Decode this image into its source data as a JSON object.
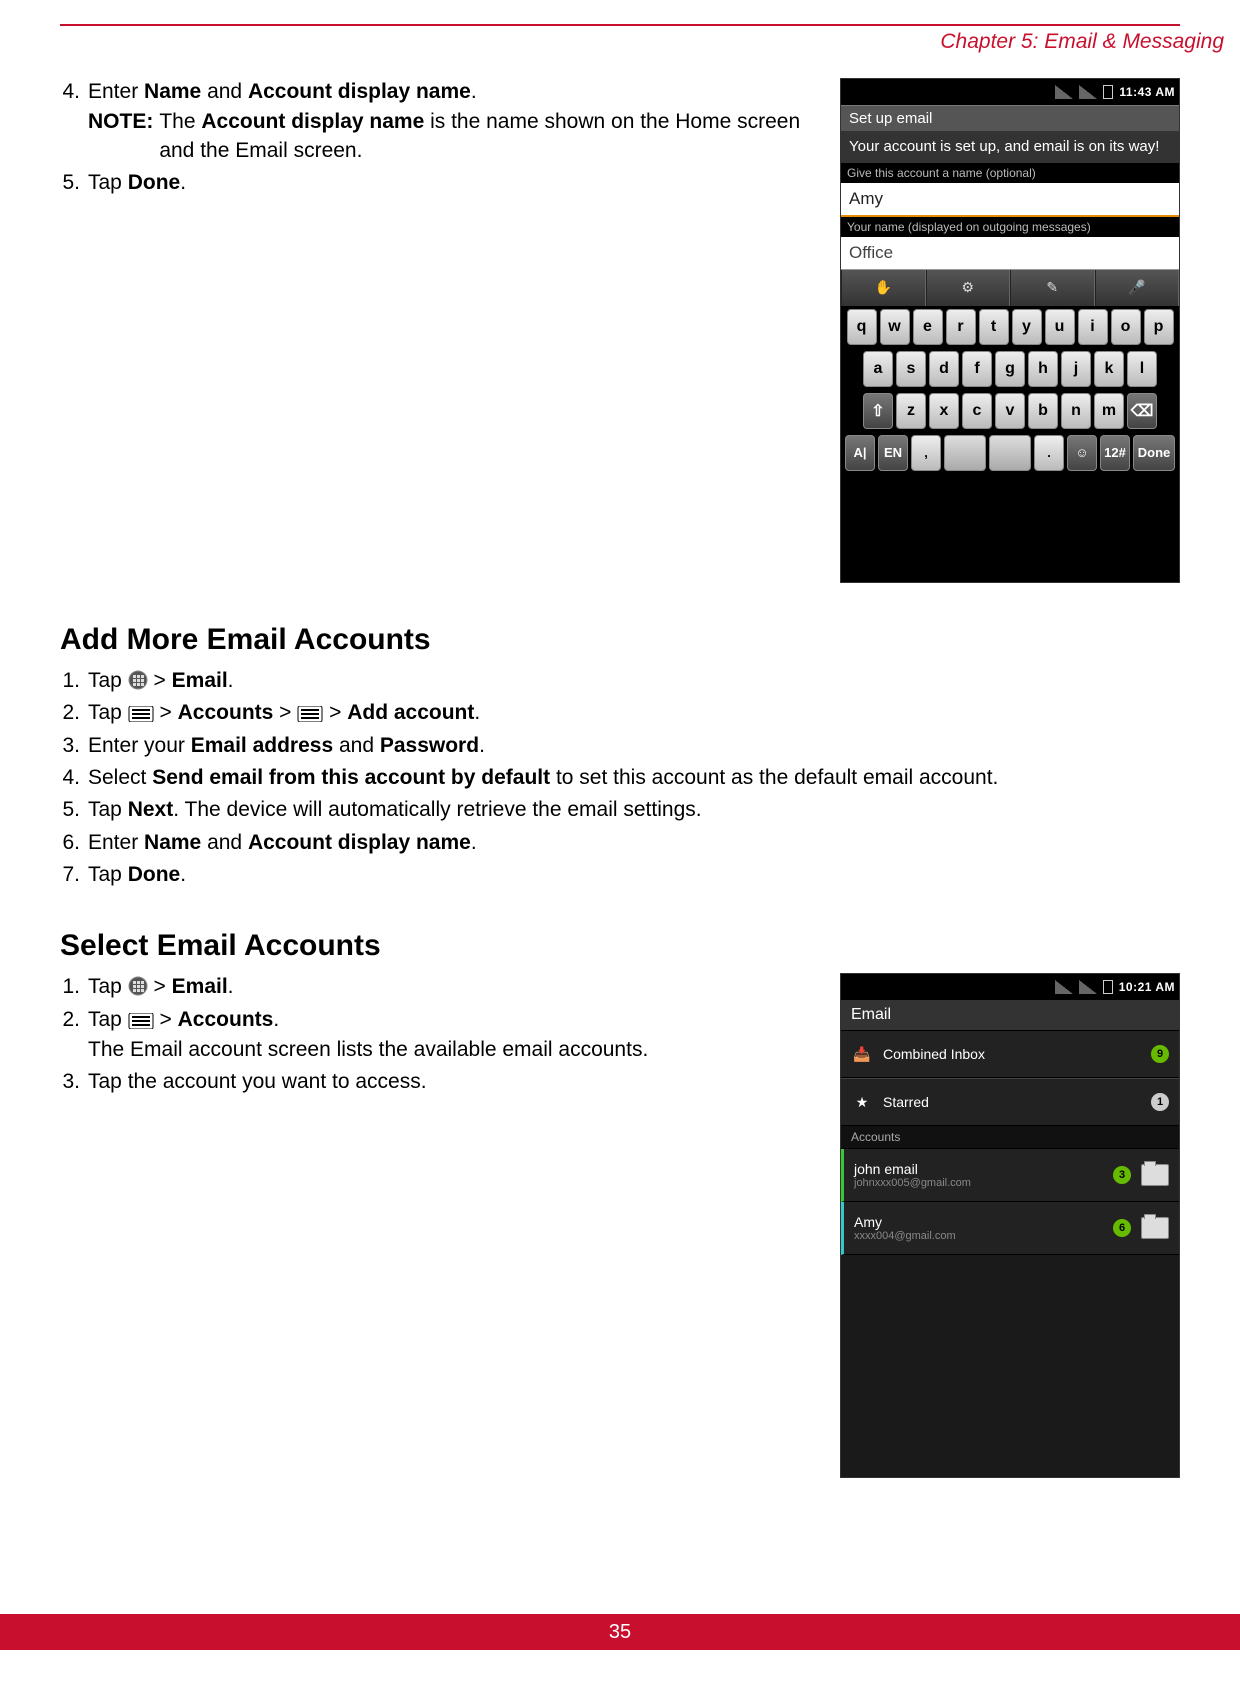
{
  "header": {
    "chapter": "Chapter 5: Email & Messaging"
  },
  "footer": {
    "page_number": "35"
  },
  "top_steps": [
    {
      "num": "4.",
      "html": "Enter <b>Name</b> and <b>Account display name</b>.",
      "note_label": "NOTE:",
      "note_html": "The <b>Account display name</b> is the name shown on the Home screen and the Email screen."
    },
    {
      "num": "5.",
      "html": "Tap <b>Done</b>."
    }
  ],
  "section_add": {
    "title": "Add More Email Accounts",
    "steps": [
      {
        "num": "1.",
        "html": "Tap {apps} > <b>Email</b>."
      },
      {
        "num": "2.",
        "html": "Tap {menu} > <b>Accounts</b> > {menu} > <b>Add account</b>."
      },
      {
        "num": "3.",
        "html": "Enter your <b>Email address</b> and <b>Password</b>."
      },
      {
        "num": "4.",
        "html": "Select <b>Send email from this account by default</b> to set this account as the default email account."
      },
      {
        "num": "5.",
        "html": "Tap <b>Next</b>. The device will automatically retrieve the email settings."
      },
      {
        "num": "6.",
        "html": "Enter <b>Name</b> and <b>Account display name</b>."
      },
      {
        "num": "7.",
        "html": "Tap <b>Done</b>."
      }
    ]
  },
  "section_select": {
    "title": "Select Email Accounts",
    "steps": [
      {
        "num": "1.",
        "html": "Tap {apps} > <b>Email</b>."
      },
      {
        "num": "2.",
        "html": "Tap {menu} > <b>Accounts</b>.",
        "extra": "The Email account screen lists the available email accounts."
      },
      {
        "num": "3.",
        "html": "Tap the account you want to access."
      }
    ]
  },
  "phone1": {
    "time": "11:43 AM",
    "title": "Set up email",
    "subtitle": "Your account is set up, and email is on its way!",
    "hint1": "Give this account a name (optional)",
    "input1": "Amy",
    "hint2": "Your name (displayed on outgoing messages)",
    "input2": "Office",
    "toolbar_icons": [
      "hand-icon",
      "gear-icon",
      "edit-icon",
      "mic-icon"
    ],
    "rows": [
      [
        "q",
        "w",
        "e",
        "r",
        "t",
        "y",
        "u",
        "i",
        "o",
        "p"
      ],
      [
        "a",
        "s",
        "d",
        "f",
        "g",
        "h",
        "j",
        "k",
        "l"
      ],
      [
        "⇧",
        "z",
        "x",
        "c",
        "v",
        "b",
        "n",
        "m",
        "⌫"
      ],
      [
        "A|",
        "EN",
        ",",
        "–",
        "–",
        ".",
        "☺",
        "12#",
        "Done"
      ]
    ]
  },
  "phone2": {
    "time": "10:21 AM",
    "appbar": "Email",
    "combined": {
      "label": "Combined Inbox",
      "badge": "9"
    },
    "starred": {
      "label": "Starred",
      "badge": "1"
    },
    "accounts_header": "Accounts",
    "accounts": [
      {
        "name": "john email",
        "addr": "johnxxx005@gmail.com",
        "badge": "3",
        "stripe": "green"
      },
      {
        "name": "Amy",
        "addr": "xxxx004@gmail.com",
        "badge": "6",
        "stripe": "teal"
      }
    ]
  }
}
